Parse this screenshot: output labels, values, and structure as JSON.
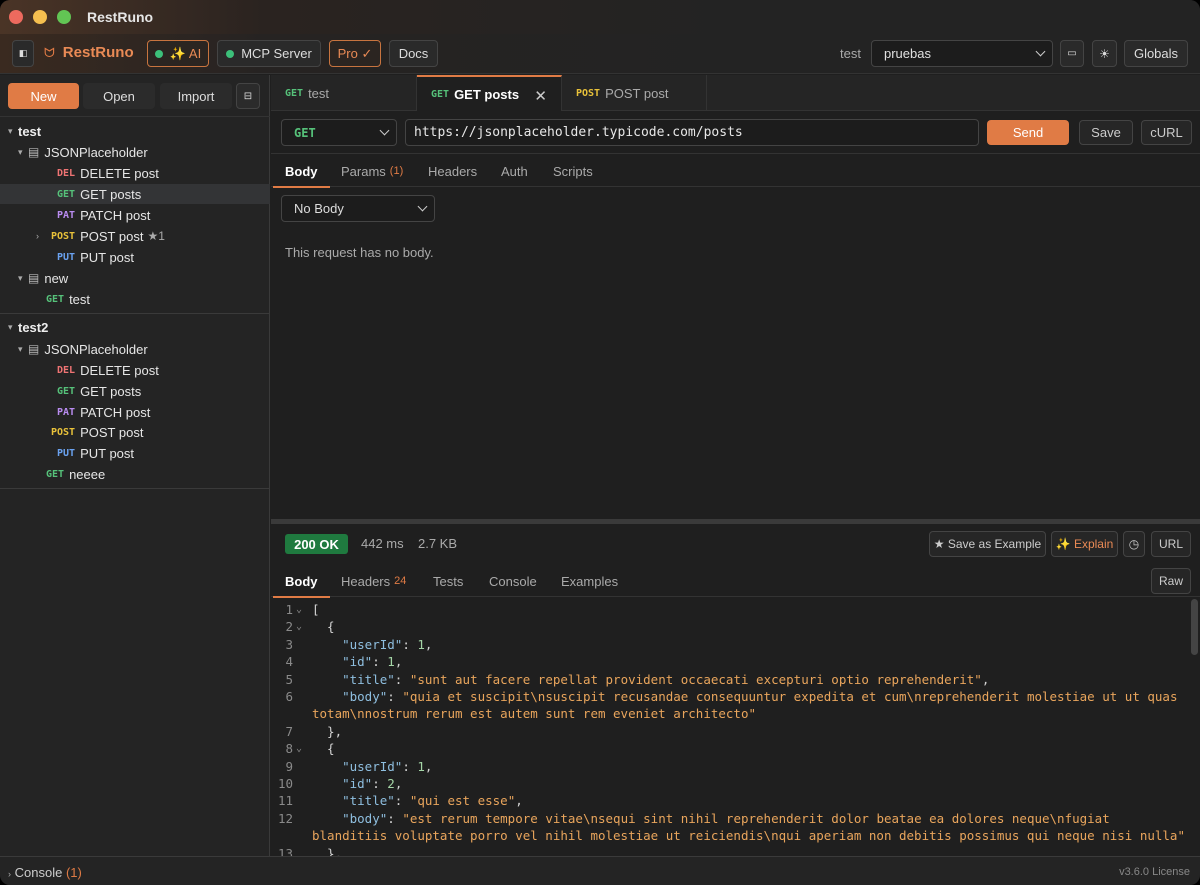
{
  "window": {
    "title": "RestRuno"
  },
  "toolbar": {
    "brand": "RestRuno",
    "ai_label": "✨ AI",
    "mcp_label": "MCP Server",
    "pro_label": "Pro ✓",
    "docs_label": "Docs",
    "env_label": "test",
    "env_value": "pruebas",
    "globals_label": "Globals"
  },
  "sidebar": {
    "new_label": "New",
    "open_label": "Open",
    "import_label": "Import",
    "collections": [
      {
        "name": "test",
        "folders": [
          {
            "name": "JSONPlaceholder",
            "requests": [
              {
                "method": "DEL",
                "name": "DELETE post"
              },
              {
                "method": "GET",
                "name": "GET posts"
              },
              {
                "method": "PAT",
                "name": "PATCH post"
              },
              {
                "method": "POST",
                "name": "POST post",
                "badge": "★1"
              },
              {
                "method": "PUT",
                "name": "PUT post"
              }
            ]
          },
          {
            "name": "new",
            "requests": [
              {
                "method": "GET",
                "name": "test"
              }
            ]
          }
        ]
      },
      {
        "name": "test2",
        "folders": [
          {
            "name": "JSONPlaceholder",
            "requests": [
              {
                "method": "DEL",
                "name": "DELETE post"
              },
              {
                "method": "GET",
                "name": "GET posts"
              },
              {
                "method": "PAT",
                "name": "PATCH post"
              },
              {
                "method": "POST",
                "name": "POST post"
              },
              {
                "method": "PUT",
                "name": "PUT post"
              }
            ]
          }
        ],
        "requests": [
          {
            "method": "GET",
            "name": "neeee"
          }
        ]
      }
    ]
  },
  "tabs": [
    {
      "method": "GET",
      "name": "test"
    },
    {
      "method": "GET",
      "name": "GET posts"
    },
    {
      "method": "POST",
      "name": "POST post"
    }
  ],
  "request": {
    "method": "GET",
    "url": "https://jsonplaceholder.typicode.com/posts",
    "send_label": "Send",
    "save_label": "Save",
    "curl_label": "cURL",
    "subtabs": {
      "body": "Body",
      "params": "Params",
      "params_count": "(1)",
      "headers": "Headers",
      "auth": "Auth",
      "scripts": "Scripts"
    },
    "body_type": "No Body",
    "no_body_text": "This request has no body."
  },
  "response": {
    "status": "200 OK",
    "time": "442 ms",
    "size": "2.7 KB",
    "save_example_label": "★ Save as Example",
    "explain_label": "✨ Explain",
    "url_label": "URL",
    "raw_label": "Raw",
    "subtabs": {
      "body": "Body",
      "headers": "Headers",
      "headers_count": "24",
      "tests": "Tests",
      "console": "Console",
      "examples": "Examples"
    }
  },
  "code_lines": [
    {
      "n": "1",
      "fold": "⌄",
      "t": "["
    },
    {
      "n": "2",
      "fold": "⌄",
      "t": "  {"
    },
    {
      "n": "3",
      "t": "    \"userId\": 1,"
    },
    {
      "n": "4",
      "t": "    \"id\": 1,"
    },
    {
      "n": "5",
      "t": "    \"title\": \"sunt aut facere repellat provident occaecati excepturi optio reprehenderit\","
    },
    {
      "n": "6",
      "t": "    \"body\": \"quia et suscipit\\nsuscipit recusandae consequuntur expedita et cum\\nreprehenderit molestiae ut ut quas"
    },
    {
      "n": "",
      "t": "totam\\nnostrum rerum est autem sunt rem eveniet architecto\""
    },
    {
      "n": "7",
      "t": "  },"
    },
    {
      "n": "8",
      "fold": "⌄",
      "t": "  {"
    },
    {
      "n": "9",
      "t": "    \"userId\": 1,"
    },
    {
      "n": "10",
      "t": "    \"id\": 2,"
    },
    {
      "n": "11",
      "t": "    \"title\": \"qui est esse\","
    },
    {
      "n": "12",
      "t": "    \"body\": \"est rerum tempore vitae\\nsequi sint nihil reprehenderit dolor beatae ea dolores neque\\nfugiat"
    },
    {
      "n": "",
      "t": "blanditiis voluptate porro vel nihil molestiae ut reiciendis\\nqui aperiam non debitis possimus qui neque nisi nulla\""
    },
    {
      "n": "13",
      "t": "  },"
    }
  ],
  "statusbar": {
    "console_label": "Console",
    "console_count": "(1)",
    "version": "v3.6.0  License"
  }
}
